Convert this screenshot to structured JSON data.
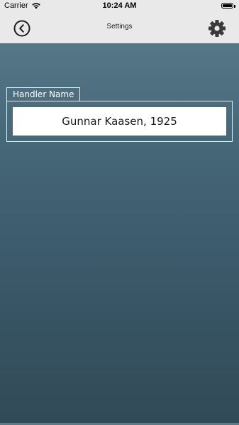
{
  "status_bar": {
    "carrier": "Carrier",
    "time": "10:24 AM",
    "wifi_icon": "wifi-icon",
    "battery_icon": "battery-icon"
  },
  "nav_bar": {
    "title": "Settings",
    "back_icon": "chevron-left-circle-icon",
    "settings_icon": "gear-icon"
  },
  "handler": {
    "legend": "Handler Name",
    "value": "Gunnar Kaasen, 1925"
  },
  "colors": {
    "nav_background": "#e9e9e9",
    "background_top": "#5d7e8d",
    "background_bottom": "#314a57",
    "field_background": "#ffffff"
  }
}
